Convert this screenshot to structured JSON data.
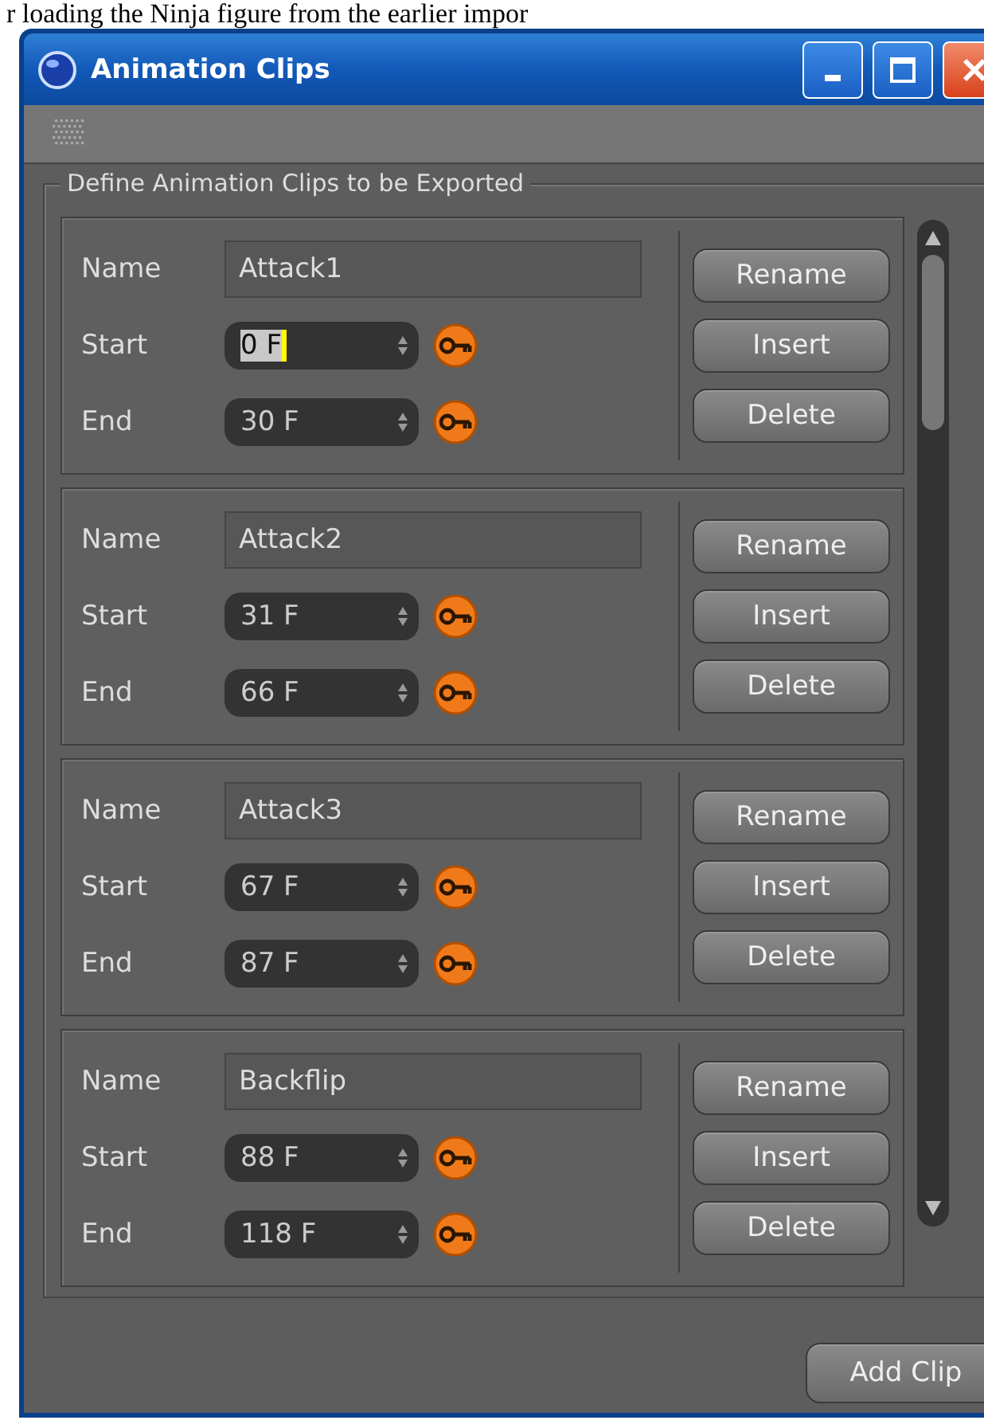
{
  "caption": "r loading the Ninja figure from the earlier impor",
  "window": {
    "title": "Animation Clips"
  },
  "group": {
    "legend": "Define Animation Clips to be Exported"
  },
  "clips": [
    {
      "labels": {
        "name": "Name",
        "start": "Start",
        "end": "End"
      },
      "name": "Attack1",
      "start": {
        "value": "0 F",
        "selected": true
      },
      "end": {
        "value": "30 F",
        "selected": false
      },
      "buttons": [
        "Rename",
        "Insert",
        "Delete"
      ]
    },
    {
      "labels": {
        "name": "Name",
        "start": "Start",
        "end": "End"
      },
      "name": "Attack2",
      "start": {
        "value": "31 F",
        "selected": false
      },
      "end": {
        "value": "66 F",
        "selected": false
      },
      "buttons": [
        "Rename",
        "Insert",
        "Delete"
      ]
    },
    {
      "labels": {
        "name": "Name",
        "start": "Start",
        "end": "End"
      },
      "name": "Attack3",
      "start": {
        "value": "67 F",
        "selected": false
      },
      "end": {
        "value": "87 F",
        "selected": false
      },
      "buttons": [
        "Rename",
        "Insert",
        "Delete"
      ]
    },
    {
      "labels": {
        "name": "Name",
        "start": "Start",
        "end": "End"
      },
      "name": "Backflip",
      "start": {
        "value": "88 F",
        "selected": false
      },
      "end": {
        "value": "118 F",
        "selected": false
      },
      "buttons": [
        "Rename",
        "Insert",
        "Delete"
      ]
    }
  ],
  "add_button": "Add Clip"
}
